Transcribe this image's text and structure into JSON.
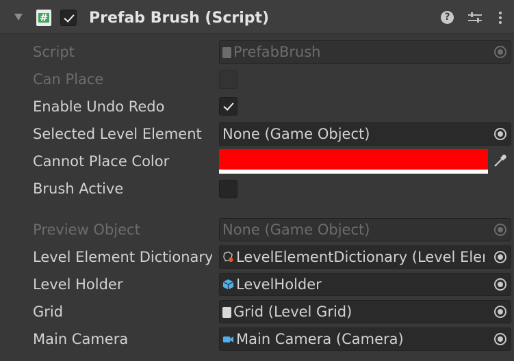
{
  "component": {
    "title": "Prefab Brush (Script)",
    "enabled": true,
    "script_icon_glyph": "#",
    "help_icon_glyph": "?"
  },
  "fields": {
    "script": {
      "label": "Script",
      "value": "PrefabBrush"
    },
    "can_place": {
      "label": "Can Place",
      "checked": false
    },
    "enable_undo_redo": {
      "label": "Enable Undo Redo",
      "checked": true
    },
    "selected_level_element": {
      "label": "Selected Level Element",
      "value": "None (Game Object)"
    },
    "cannot_place_color": {
      "label": "Cannot Place Color",
      "color": "#ff0000"
    },
    "brush_active": {
      "label": "Brush Active",
      "checked": false
    },
    "preview_object": {
      "label": "Preview Object",
      "value": "None (Game Object)"
    },
    "level_element_dictionary": {
      "label": "Level Element Dictionary",
      "value": "LevelElementDictionary (Level Element Dictionary)"
    },
    "level_holder": {
      "label": "Level Holder",
      "value": "LevelHolder"
    },
    "grid": {
      "label": "Grid",
      "value": "Grid (Level Grid)"
    },
    "main_camera": {
      "label": "Main Camera",
      "value": "Main Camera (Camera)"
    }
  },
  "icons": {
    "script_file": "script-file-icon",
    "scriptable_object": "scriptable-object-icon",
    "prefab": "prefab-cube-icon",
    "camera": "camera-icon"
  },
  "colors": {
    "panel_bg": "#383838",
    "header_bg": "#3e3e3e",
    "field_bg": "#2a2a2a",
    "text": "#d2d2d2",
    "text_disabled": "#6c6c6c",
    "script_icon_green": "#3ea55a",
    "prefab_blue": "#4fb0e8"
  }
}
